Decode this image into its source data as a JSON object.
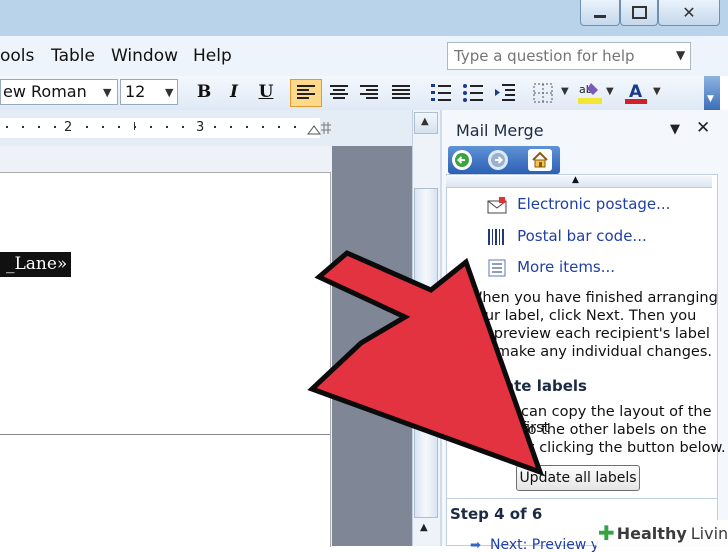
{
  "menu": {
    "tools": "ools",
    "table": "Table",
    "window": "Window",
    "help": "Help"
  },
  "help_box": {
    "placeholder": "Type a question for help"
  },
  "toolbar": {
    "font_name": "ew Roman",
    "font_size": "12",
    "bold": "B",
    "italic": "I",
    "underline": "U"
  },
  "ruler": {
    "mark2": "2",
    "mark3": "3"
  },
  "document": {
    "merge_field": "_Lane»"
  },
  "task_pane": {
    "title": "Mail Merge",
    "items": [
      {
        "label": "Electronic postage...",
        "icon": "envelope-icon"
      },
      {
        "label": "Postal bar code...",
        "icon": "barcode-icon"
      },
      {
        "label": "More items...",
        "icon": "list-icon"
      }
    ],
    "instructions": [
      "When you have finished arranging",
      "our label, click Next. Then you",
      "n preview each recipient's label",
      "d make any individual changes."
    ],
    "section_title": "ate labels",
    "section_text": [
      "can copy the layout of the first",
      "to the other labels on the",
      "y clicking the button below."
    ],
    "update_button": "Update all labels",
    "step": "Step 4 of 6",
    "next_link": "Next: Preview y"
  },
  "watermark": {
    "brand": "Healthy",
    "brand2": "Living"
  },
  "colors": {
    "arrow_fill": "#e33240",
    "arrow_stroke": "#0b0b0b",
    "link": "#1f3fa8",
    "titlebar": "#b9d4ea",
    "highlight_yellow": "#f3e534",
    "font_color_red": "#d0202a"
  }
}
